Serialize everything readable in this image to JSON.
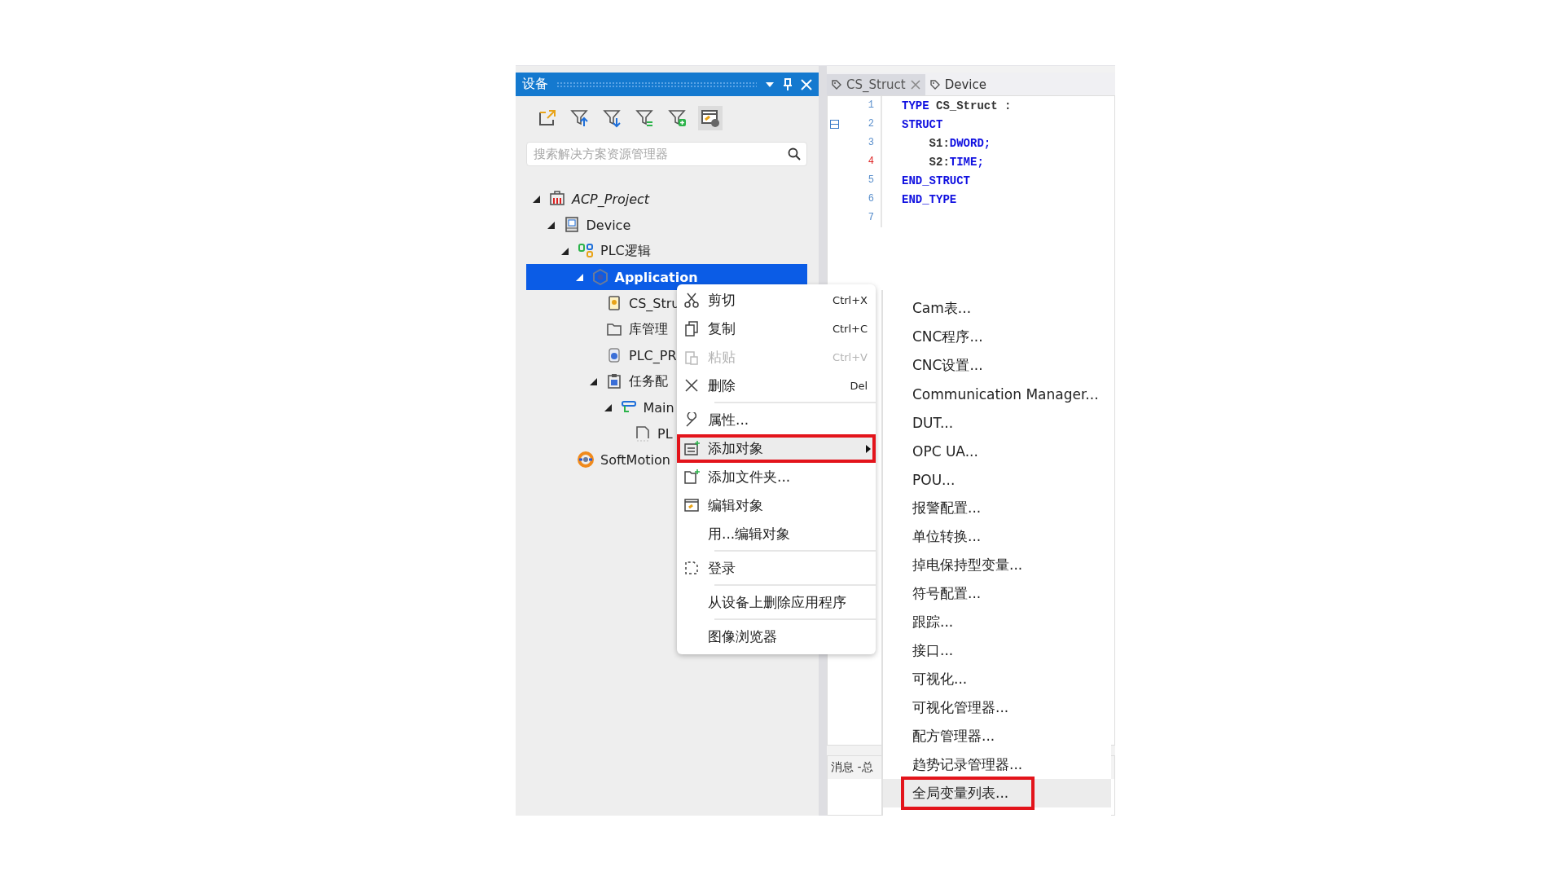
{
  "device_panel": {
    "title": "设备",
    "search": {
      "placeholder": "搜索解决方案资源管理器"
    },
    "tree": [
      {
        "label": "ACP_Project",
        "kind": "project",
        "expanded": true,
        "selected": false,
        "children": [
          {
            "label": "Device",
            "kind": "device",
            "expanded": true,
            "selected": false,
            "children": [
              {
                "label": "PLC逻辑",
                "kind": "logic",
                "expanded": true,
                "selected": false,
                "children": [
                  {
                    "label": "Application",
                    "kind": "application",
                    "expanded": true,
                    "selected": true,
                    "children": [
                      {
                        "label": "CS_Stru",
                        "kind": "dut",
                        "selected": false
                      },
                      {
                        "label": "库管理",
                        "kind": "folder",
                        "selected": false
                      },
                      {
                        "label": "PLC_PR",
                        "kind": "program",
                        "selected": false
                      },
                      {
                        "label": "任务配",
                        "kind": "tasks",
                        "expanded": true,
                        "selected": false,
                        "children": [
                          {
                            "label": "Main",
                            "kind": "task",
                            "expanded": true,
                            "selected": false,
                            "children": [
                              {
                                "label": "PL",
                                "kind": "call",
                                "selected": false
                              }
                            ]
                          }
                        ]
                      }
                    ]
                  }
                ]
              },
              {
                "label": "SoftMotion",
                "kind": "motion",
                "selected": false
              }
            ]
          }
        ]
      }
    ]
  },
  "editor": {
    "tabs": [
      {
        "label": "CS_Struct",
        "selected": true
      },
      {
        "label": "Device",
        "selected": false
      }
    ],
    "lines": [
      {
        "number": "1",
        "marked": false,
        "foldable": false,
        "tokens": [
          {
            "kind": "keyword",
            "text": "TYPE"
          },
          {
            "kind": "plain",
            "text": " CS_Struct :"
          }
        ]
      },
      {
        "number": "2",
        "marked": false,
        "foldable": true,
        "tokens": [
          {
            "kind": "keyword",
            "text": "STRUCT"
          }
        ]
      },
      {
        "number": "3",
        "marked": false,
        "foldable": false,
        "tokens": [
          {
            "kind": "plain",
            "text": "    S1:"
          },
          {
            "kind": "keyword",
            "text": "DWORD;"
          }
        ]
      },
      {
        "number": "4",
        "marked": true,
        "foldable": false,
        "tokens": [
          {
            "kind": "plain",
            "text": "    S2:"
          },
          {
            "kind": "keyword",
            "text": "TIME;"
          }
        ]
      },
      {
        "number": "5",
        "marked": false,
        "foldable": false,
        "tokens": [
          {
            "kind": "keyword",
            "text": "END_STRUCT"
          }
        ]
      },
      {
        "number": "6",
        "marked": false,
        "foldable": false,
        "tokens": [
          {
            "kind": "keyword",
            "text": "END_TYPE"
          }
        ]
      },
      {
        "number": "7",
        "marked": false,
        "foldable": false
      }
    ]
  },
  "messages": {
    "title": "消息 -总"
  },
  "context_menu": [
    {
      "kind": "cut",
      "label": "剪切",
      "shortcut": "Ctrl+X",
      "disabled": false,
      "highlighted": false
    },
    {
      "kind": "copy",
      "label": "复制",
      "shortcut": "Ctrl+C",
      "disabled": false,
      "highlighted": false
    },
    {
      "kind": "paste",
      "label": "粘贴",
      "shortcut": "Ctrl+V",
      "disabled": true,
      "highlighted": false
    },
    {
      "kind": "delete",
      "label": "删除",
      "shortcut": "Del",
      "disabled": false,
      "highlighted": false
    },
    {
      "kind": "separator"
    },
    {
      "kind": "properties",
      "label": "属性...",
      "disabled": false,
      "highlighted": false
    },
    {
      "kind": "add-object",
      "label": "添加对象",
      "submenu": true,
      "disabled": false,
      "highlighted": true
    },
    {
      "kind": "add-folder",
      "label": "添加文件夹...",
      "disabled": false,
      "highlighted": false
    },
    {
      "kind": "edit",
      "label": "编辑对象",
      "disabled": false,
      "highlighted": false
    },
    {
      "kind": "edit-with",
      "label": "用...编辑对象",
      "disabled": false,
      "highlighted": false
    },
    {
      "kind": "separator"
    },
    {
      "kind": "login",
      "label": "登录",
      "disabled": false,
      "highlighted": false
    },
    {
      "kind": "separator"
    },
    {
      "kind": "remove-app",
      "label": "从设备上删除应用程序",
      "disabled": false,
      "highlighted": false
    },
    {
      "kind": "separator"
    },
    {
      "kind": "image-browser",
      "label": "图像浏览器",
      "disabled": false,
      "highlighted": false
    }
  ],
  "submenu": [
    {
      "label": "Cam表...",
      "highlighted": false
    },
    {
      "label": "CNC程序...",
      "highlighted": false
    },
    {
      "label": "CNC设置...",
      "highlighted": false
    },
    {
      "label": "Communication Manager...",
      "highlighted": false
    },
    {
      "label": "DUT...",
      "highlighted": false
    },
    {
      "label": "OPC UA...",
      "highlighted": false
    },
    {
      "label": "POU...",
      "highlighted": false
    },
    {
      "label": "报警配置...",
      "highlighted": false
    },
    {
      "label": "单位转换...",
      "highlighted": false
    },
    {
      "label": "掉电保持型变量...",
      "highlighted": false
    },
    {
      "label": "符号配置...",
      "highlighted": false
    },
    {
      "label": "跟踪...",
      "highlighted": false
    },
    {
      "label": "接口...",
      "highlighted": false
    },
    {
      "label": "可视化...",
      "highlighted": false
    },
    {
      "label": "可视化管理器...",
      "highlighted": false
    },
    {
      "label": "配方管理器...",
      "highlighted": false
    },
    {
      "label": "趋势记录管理器...",
      "highlighted": false
    },
    {
      "label": "全局变量列表...",
      "highlighted": true
    }
  ]
}
